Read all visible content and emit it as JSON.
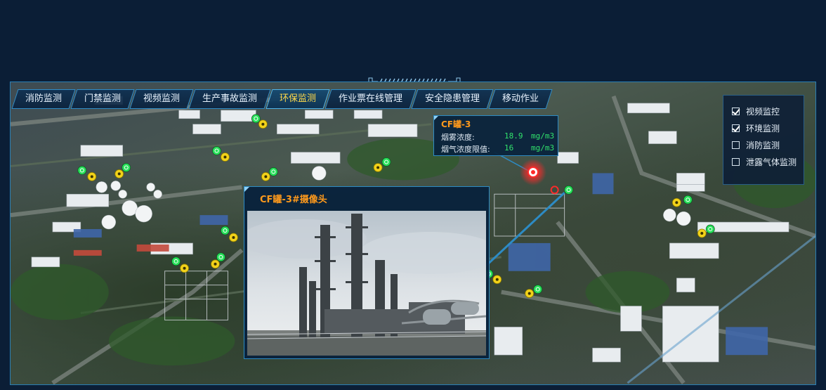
{
  "tabs": [
    {
      "label": "消防监测",
      "active": false
    },
    {
      "label": "门禁监测",
      "active": false
    },
    {
      "label": "视频监测",
      "active": false
    },
    {
      "label": "生产事故监测",
      "active": false
    },
    {
      "label": "环保监测",
      "active": true
    },
    {
      "label": "作业票在线管理",
      "active": false
    },
    {
      "label": "安全隐患管理",
      "active": false
    },
    {
      "label": "移动作业",
      "active": false
    }
  ],
  "legend": [
    {
      "label": "视频监控",
      "checked": true
    },
    {
      "label": "环境监测",
      "checked": true
    },
    {
      "label": "消防监测",
      "checked": false
    },
    {
      "label": "泄露气体监测",
      "checked": false
    }
  ],
  "info_popup": {
    "title": "CF罐-3",
    "rows": [
      {
        "label": "烟雾浓度:",
        "value": "18.9",
        "unit": "mg/m3"
      },
      {
        "label": "烟气浓度限值:",
        "value": "16",
        "unit": "mg/m3"
      }
    ]
  },
  "camera_popup": {
    "title": "CF罐-3#摄像头"
  },
  "markers": {
    "camera_icon": "camera-pin-icon",
    "env_icon": "environment-pin-icon",
    "alarm_icon": "alarm-pin-icon"
  },
  "colors": {
    "accent": "#2d8bc4",
    "active_tab_text": "#ffd94a",
    "title_orange": "#ff9a1c",
    "value_green": "#31e26c",
    "alarm_red": "#ff2a2a",
    "marker_green": "#28e05a",
    "marker_yellow": "#f2d21a"
  }
}
